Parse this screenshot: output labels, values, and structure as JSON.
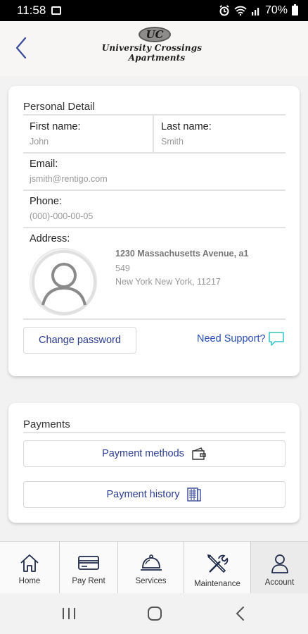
{
  "status_bar": {
    "time": "11:58",
    "battery": "70%"
  },
  "header": {
    "logo_monogram": "UC",
    "logo_line1": "University Crossings",
    "logo_line2": "Apartments"
  },
  "personal": {
    "section_title": "Personal Detail",
    "first_name_label": "First name:",
    "first_name_value": "John",
    "last_name_label": "Last name:",
    "last_name_value": "Smith",
    "email_label": "Email:",
    "email_value": "jsmith@rentigo.com",
    "phone_label": "Phone:",
    "phone_value": "(000)-000-00-05",
    "address_label": "Address:",
    "address_line1": "1230 Massachusetts Avenue, a1",
    "address_line2": "549",
    "address_line3": "New York New York, 11217",
    "change_password_label": "Change password",
    "support_label": "Need Support?"
  },
  "payments": {
    "section_title": "Payments",
    "methods_label": "Payment methods",
    "history_label": "Payment history"
  },
  "nav": {
    "items": [
      {
        "label": "Home",
        "icon": "home-icon"
      },
      {
        "label": "Pay Rent",
        "icon": "credit-card-icon"
      },
      {
        "label": "Services",
        "icon": "cloche-icon"
      },
      {
        "label": "Maintenance",
        "icon": "tools-icon"
      },
      {
        "label": "Account",
        "icon": "person-icon"
      }
    ],
    "active_index": 4
  },
  "colors": {
    "accent_text": "#2a3b8f",
    "support_link": "#2a4fb5",
    "support_icon": "#2ec4c6"
  }
}
